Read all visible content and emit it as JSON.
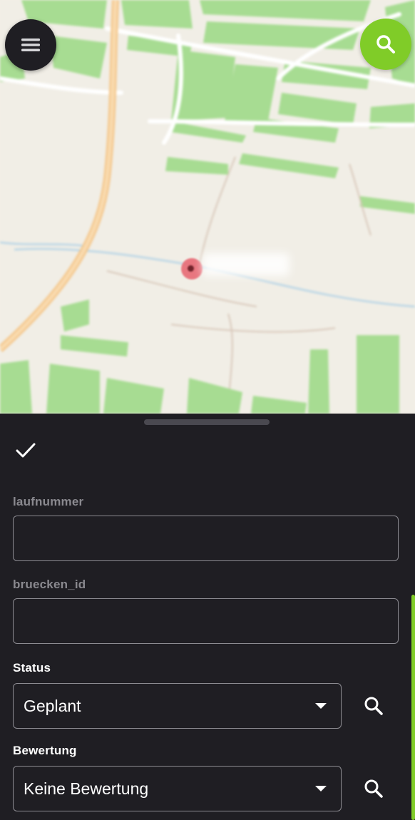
{
  "map": {
    "menu_icon": "hamburger-menu-icon",
    "search_icon": "search-icon",
    "accent_color": "#80cc28",
    "marker_color": "#e8707a"
  },
  "sheet": {
    "confirm_icon": "check-icon",
    "fields": {
      "laufnummer": {
        "label": "laufnummer",
        "value": "",
        "placeholder": ""
      },
      "bruecken_id": {
        "label": "bruecken_id",
        "value": "",
        "placeholder": ""
      },
      "status": {
        "label": "Status",
        "selected": "Geplant"
      },
      "bewertung": {
        "label": "Bewertung",
        "selected": "Keine Bewertung"
      }
    }
  }
}
